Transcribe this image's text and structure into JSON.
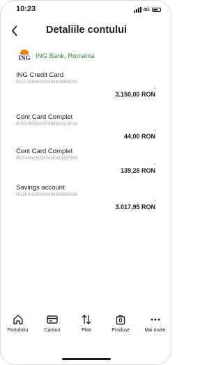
{
  "status": {
    "time": "10:23",
    "network": "4G"
  },
  "header": {
    "title": "Detaliile contului",
    "back_icon": "chevron-left-icon"
  },
  "bank": {
    "name": "ING Bank, Romania",
    "logo_text": "ING",
    "color": "#2e8b3e"
  },
  "accounts": [
    {
      "name": "ING Credit Card",
      "iban": "RO21INGB0000999908363000",
      "amount": "3.150,00 RON"
    },
    {
      "name": "Cont Card Complet",
      "iban": "RO02INGB0000999910204014",
      "amount": "44,00 RON"
    },
    {
      "name": "Cont Card Complet",
      "iban": "RO74INGB0000999906890556",
      "amount": "139,28 RON"
    },
    {
      "name": "Savings account",
      "iban": "RO20INGB0000999906890558",
      "amount": "3.017,95 RON"
    }
  ],
  "tabs": [
    {
      "label": "Portofoliu",
      "icon": "home-icon"
    },
    {
      "label": "Carduri",
      "icon": "card-icon"
    },
    {
      "label": "Plati",
      "icon": "transfer-arrows-icon"
    },
    {
      "label": "Produse",
      "icon": "product-bag-icon"
    },
    {
      "label": "Mai multe",
      "icon": "more-dots-icon"
    }
  ]
}
